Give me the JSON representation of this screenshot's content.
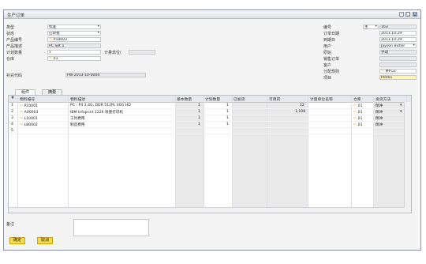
{
  "window": {
    "title": "生产订单"
  },
  "left_fields": {
    "type": {
      "label": "类型",
      "value": "标准"
    },
    "status": {
      "label": "状态",
      "value": "已审批"
    },
    "product_no": {
      "label": "产品编号",
      "value": "P10003"
    },
    "product_desc": {
      "label": "产品描述",
      "value": "PC Set 1"
    },
    "planned_qty": {
      "label": "计划数量",
      "value": "1"
    },
    "unit_label": "计量单位(",
    "warehouse": {
      "label": "仓库",
      "value": "01"
    },
    "batch_label": "补充代码",
    "batch_value": "PW-2013-10-0004"
  },
  "right_fields": {
    "number": {
      "label": "编号",
      "series": "主",
      "value": "163"
    },
    "order_date": {
      "label": "订单日期",
      "value": "2013.10.29"
    },
    "due_date": {
      "label": "到期日",
      "value": "2013.10.29"
    },
    "user": {
      "label": "用户",
      "value": "Jayson Butler"
    },
    "origin": {
      "label": "原始",
      "value": "手动"
    },
    "sales_order": {
      "label": "销售订单",
      "value": ""
    },
    "customer": {
      "label": "客户",
      "value": ""
    },
    "dist_rule": {
      "label": "分配规则",
      "value": "MFG2"
    },
    "project": {
      "label": "项目",
      "value": "P0001"
    }
  },
  "tabs": [
    {
      "label": "组件"
    },
    {
      "label": "摘要"
    }
  ],
  "grid": {
    "headers": [
      "#",
      "物料编号",
      "物料描述",
      "基本数量",
      "计划数量",
      "已发货",
      "可用的",
      "计量单位名称",
      "仓库",
      "发货方法"
    ],
    "rows": [
      {
        "n": "1",
        "item": "P10001",
        "desc": "PC - P4 2.4G, DDR 512M, 40G HD",
        "base": "1",
        "planned": "1",
        "issued": "",
        "available": "12",
        "uom": "",
        "wh": "01",
        "method": "倒冲"
      },
      {
        "n": "2",
        "item": "A00003",
        "desc": "IBM Infoprint 1226 喷墨打印机",
        "base": "1",
        "planned": "1",
        "issued": "",
        "available": "1,108",
        "uom": "",
        "wh": "01",
        "method": "倒冲"
      },
      {
        "n": "3",
        "item": "L10001",
        "desc": "工时费用",
        "base": "1",
        "planned": "1",
        "issued": "",
        "available": "",
        "uom": "",
        "wh": "01",
        "method": "倒冲"
      },
      {
        "n": "4",
        "item": "L80002",
        "desc": "制造费用",
        "base": "1",
        "planned": "1",
        "issued": "",
        "available": "",
        "uom": "",
        "wh": "01",
        "method": "倒冲"
      },
      {
        "n": "5",
        "item": "",
        "desc": "",
        "base": "",
        "planned": "",
        "issued": "",
        "available": "",
        "uom": "",
        "wh": "",
        "method": ""
      }
    ]
  },
  "remarks_label": "备注",
  "buttons": {
    "ok": "确定",
    "cancel": "取消"
  },
  "colors": {
    "accent_yellow": "#f6d94a",
    "link_arrow": "#e8a213",
    "title_button": "#6b7aa8"
  }
}
